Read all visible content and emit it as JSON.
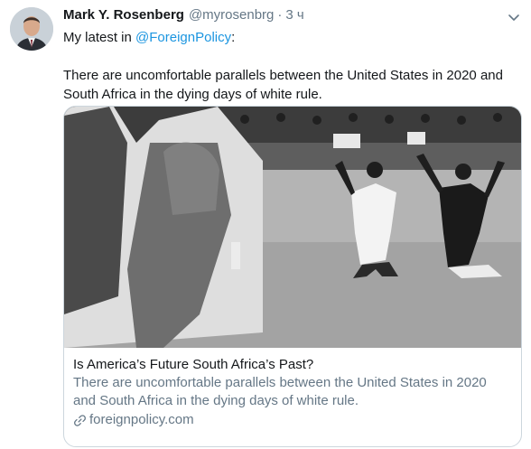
{
  "tweet": {
    "author_name": "Mark Y. Rosenberg",
    "author_handle": "@myrosenbrg",
    "separator": "·",
    "timestamp": "3 ч",
    "intro_text": "My latest in ",
    "mention": "@ForeignPolicy",
    "intro_suffix": ":",
    "body": "There are uncomfortable parallels between the United States in 2020 and South Africa in the dying days of white rule."
  },
  "card": {
    "title": "Is America’s Future South Africa’s Past?",
    "description": "There are uncomfortable parallels between the United States in 2020 and South Africa in the dying days of white rule.",
    "domain": "foreignpolicy.com"
  },
  "icons": {
    "caret": "chevron-down-icon",
    "link": "link-icon"
  },
  "colors": {
    "text_primary": "#14171a",
    "text_secondary": "#657786",
    "accent": "#1b95e0",
    "border": "#ccd6dd"
  }
}
